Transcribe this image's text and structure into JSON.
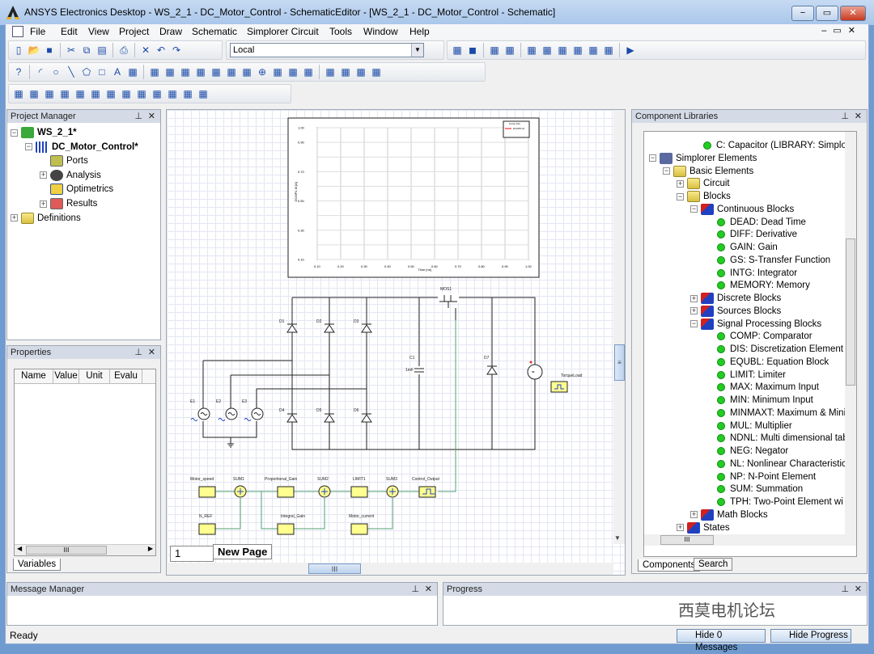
{
  "window": {
    "title": "ANSYS Electronics Desktop - WS_2_1 - DC_Motor_Control - SchematicEditor - [WS_2_1 - DC_Motor_Control - Schematic]",
    "minimize": "−",
    "restore": "▭",
    "close": "✕"
  },
  "menu": [
    "File",
    "Edit",
    "View",
    "Project",
    "Draw",
    "Schematic",
    "Simplorer Circuit",
    "Tools",
    "Window",
    "Help"
  ],
  "toolbar": {
    "machine_select": "Local",
    "row1_icons": [
      "new-icon",
      "open-icon",
      "save-icon",
      "cut-icon",
      "copy-icon",
      "paste-icon",
      "print-icon",
      "delete-icon",
      "undo-icon",
      "redo-icon"
    ],
    "row1b_icons": [
      "properties-icon",
      "stop-icon",
      "netlist-icon",
      "validate-icon",
      "analyze-icon",
      "sweep-icon",
      "report-icon",
      "table-icon",
      "matrix-icon",
      "probe-icon",
      "run-icon"
    ],
    "row2_icons": [
      "help-icon",
      "arc-icon",
      "circle-icon",
      "line-icon",
      "polygon-icon",
      "rectangle-icon",
      "text-icon",
      "image-icon",
      "plot-icon",
      "table-report-icon",
      "rect-plot-icon",
      "eye-plot-icon",
      "smith-chart-icon",
      "polar-plot-icon",
      "radiation-plot-icon",
      "crosshair-icon",
      "data-table-icon",
      "grid-icon",
      "marker-icon",
      "trace-icon",
      "export-icon",
      "ruler-icon",
      "probe-icon"
    ],
    "row3_icons": [
      "circuit-icon",
      "elements-icon",
      "peace-icon",
      "spiral-icon",
      "flag-icon",
      "wires-icon",
      "transformer-icon",
      "machine-icon",
      "sensor-icon",
      "grid-component-icon",
      "filter-icon",
      "magnet-icon",
      "coil-icon"
    ]
  },
  "project_manager": {
    "title": "Project Manager",
    "items": [
      {
        "label": "WS_2_1*",
        "level": 0,
        "exp": "-",
        "icon": "proj",
        "bold": true
      },
      {
        "label": "DC_Motor_Control*",
        "level": 1,
        "exp": "-",
        "icon": "design",
        "bold": true
      },
      {
        "label": "Ports",
        "level": 2,
        "exp": "",
        "icon": "ports"
      },
      {
        "label": "Analysis",
        "level": 2,
        "exp": "+",
        "icon": "gear"
      },
      {
        "label": "Optimetrics",
        "level": 2,
        "exp": "",
        "icon": "opt"
      },
      {
        "label": "Results",
        "level": 2,
        "exp": "+",
        "icon": "res"
      },
      {
        "label": "Definitions",
        "level": 1,
        "exp": "+",
        "icon": "folder",
        "shift": -1
      }
    ]
  },
  "properties": {
    "title": "Properties",
    "columns": [
      "Name",
      "Value",
      "Unit",
      "Evalu"
    ],
    "tab": "Variables"
  },
  "schematic": {
    "tabs": {
      "page_number": "1",
      "new_page": "New Page"
    },
    "labels": {
      "mos": "MOS1",
      "d1": "D1",
      "d2": "D2",
      "d3": "D3",
      "d4": "D4",
      "d5": "D5",
      "d6": "D6",
      "d7": "D7",
      "c1": "C1",
      "c1_value": "1mF",
      "e1": "E1",
      "e2": "E2",
      "e3": "E3",
      "torque": "TorqueLoad",
      "motor_speed": "Motor_speed",
      "sum1": "SUM1",
      "prop_gain": "Proportional_Gain",
      "sum2": "SUM2",
      "limit1": "LIMIT1",
      "sum3": "SUM3",
      "control_output": "Control_Output",
      "n_ref": "N_REF",
      "integral_gain": "Integral_Gain",
      "motor_current": "Motor_current"
    }
  },
  "chart_data": {
    "type": "line",
    "title": "",
    "xlabel": "Time [ns]",
    "ylabel": "DCMP1.M [A]",
    "xlim": [
      0.1,
      1.0
    ],
    "ylim": [
      0.1,
      1.0
    ],
    "xticks": [
      "0.10",
      "0.20",
      "0.30",
      "0.40",
      "0.50",
      "0.60",
      "0.70",
      "0.80",
      "0.90",
      "1.00"
    ],
    "yticks": [
      "1.00",
      "0.90",
      "0.70",
      "0.50",
      "0.30",
      "0.10"
    ],
    "grid": true,
    "legend_title": "Curve Info",
    "legend_placement": "top-right",
    "series": [
      {
        "name": "DCMP1.M",
        "values": []
      }
    ],
    "series_color": "#ff0000"
  },
  "component_libraries": {
    "title": "Component Libraries",
    "tabs": [
      "Components",
      "Search"
    ],
    "items": [
      {
        "label": "C: Capacitor (LIBRARY: Simplorer Eleme",
        "level": 3,
        "icon": "dot",
        "exp": ""
      },
      {
        "label": "Simplorer Elements",
        "level": 0,
        "icon": "pc",
        "exp": "-"
      },
      {
        "label": "Basic Elements",
        "level": 1,
        "icon": "folder",
        "exp": "-"
      },
      {
        "label": "Circuit",
        "level": 2,
        "icon": "folder",
        "exp": "+"
      },
      {
        "label": "Blocks",
        "level": 2,
        "icon": "folder",
        "exp": "-"
      },
      {
        "label": "Continuous Blocks",
        "level": 3,
        "icon": "lib",
        "exp": "-"
      },
      {
        "label": "DEAD: Dead Time",
        "level": 4,
        "icon": "dot",
        "exp": ""
      },
      {
        "label": "DIFF: Derivative",
        "level": 4,
        "icon": "dot",
        "exp": ""
      },
      {
        "label": "GAIN: Gain",
        "level": 4,
        "icon": "dot",
        "exp": ""
      },
      {
        "label": "GS: S-Transfer Function",
        "level": 4,
        "icon": "dot",
        "exp": ""
      },
      {
        "label": "INTG: Integrator",
        "level": 4,
        "icon": "dot",
        "exp": ""
      },
      {
        "label": "MEMORY: Memory",
        "level": 4,
        "icon": "dot",
        "exp": ""
      },
      {
        "label": "Discrete Blocks",
        "level": 3,
        "icon": "lib",
        "exp": "+"
      },
      {
        "label": "Sources Blocks",
        "level": 3,
        "icon": "lib",
        "exp": "+"
      },
      {
        "label": "Signal Processing Blocks",
        "level": 3,
        "icon": "lib",
        "exp": "-"
      },
      {
        "label": "COMP: Comparator",
        "level": 4,
        "icon": "dot",
        "exp": ""
      },
      {
        "label": "DIS: Discretization Element",
        "level": 4,
        "icon": "dot",
        "exp": ""
      },
      {
        "label": "EQUBL: Equation Block",
        "level": 4,
        "icon": "dot",
        "exp": ""
      },
      {
        "label": "LIMIT: Limiter",
        "level": 4,
        "icon": "dot",
        "exp": ""
      },
      {
        "label": "MAX: Maximum Input",
        "level": 4,
        "icon": "dot",
        "exp": ""
      },
      {
        "label": "MIN: Minimum Input",
        "level": 4,
        "icon": "dot",
        "exp": ""
      },
      {
        "label": "MINMAXT: Maximum & Mini",
        "level": 4,
        "icon": "dot",
        "exp": ""
      },
      {
        "label": "MUL: Multiplier",
        "level": 4,
        "icon": "dot",
        "exp": ""
      },
      {
        "label": "NDNL: Multi dimensional tab",
        "level": 4,
        "icon": "dot",
        "exp": ""
      },
      {
        "label": "NEG: Negator",
        "level": 4,
        "icon": "dot",
        "exp": ""
      },
      {
        "label": "NL: Nonlinear Characteristic",
        "level": 4,
        "icon": "dot",
        "exp": ""
      },
      {
        "label": "NP: N-Point Element",
        "level": 4,
        "icon": "dot",
        "exp": ""
      },
      {
        "label": "SUM: Summation",
        "level": 4,
        "icon": "dot",
        "exp": ""
      },
      {
        "label": "TPH: Two-Point Element wi",
        "level": 4,
        "icon": "dot",
        "exp": ""
      },
      {
        "label": "Math Blocks",
        "level": 3,
        "icon": "lib",
        "exp": "+"
      },
      {
        "label": "States",
        "level": 2,
        "icon": "lib",
        "exp": "+"
      }
    ]
  },
  "message_manager": {
    "title": "Message Manager"
  },
  "progress": {
    "title": "Progress"
  },
  "status": {
    "text": "Ready",
    "hide_messages": "Hide 0 Messages",
    "hide_progress": "Hide Progress"
  },
  "watermark": "西莫电机论坛"
}
